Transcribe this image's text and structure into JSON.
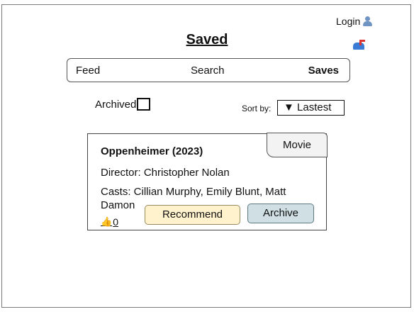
{
  "header": {
    "login_label": "Login",
    "login_icon": "user-icon",
    "mail_icon": "mailbox-icon"
  },
  "page": {
    "title": "Saved"
  },
  "nav": {
    "tabs": [
      "Feed",
      "Search",
      "Saves"
    ],
    "active": "Saves"
  },
  "filters": {
    "archived_label": "Archived",
    "archived_checked": false,
    "sort_label": "Sort by:",
    "sort_value": "▼ Lastest"
  },
  "card": {
    "tag": "Movie",
    "title": "Oppenheimer (2023)",
    "director": "Director: Christopher Nolan",
    "casts": "Casts: Cillian Murphy, Emily Blunt, Matt Damon",
    "likes": "0",
    "recommend_label": "Recommend",
    "archive_label": "Archive"
  },
  "colors": {
    "recommend_bg": "#fff2cc",
    "archive_bg": "#cfdfe4",
    "tag_bg": "#f3f3f3"
  }
}
